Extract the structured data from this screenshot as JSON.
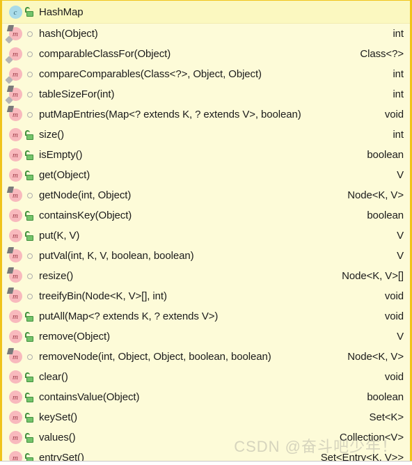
{
  "panel": {
    "kind": "structure-popup",
    "accent_border_color": "#f0c419",
    "background_color": "#fdfbd8",
    "header_background_color": "#fbf8c0",
    "text_color": "#1b1b1b"
  },
  "header": {
    "icon": "class-icon",
    "visibility_icon": "lock-open-icon",
    "name": "HashMap",
    "type": ""
  },
  "members": [
    {
      "icon": "method-icon",
      "modifiers": [
        "static",
        "final"
      ],
      "visibility_icon": "dot-private-icon",
      "name": "hash(Object)",
      "type": "int"
    },
    {
      "icon": "method-icon",
      "modifiers": [
        "final"
      ],
      "visibility_icon": "dot-private-icon",
      "name": "comparableClassFor(Object)",
      "type": "Class<?>"
    },
    {
      "icon": "method-icon",
      "modifiers": [
        "final"
      ],
      "visibility_icon": "dot-private-icon",
      "name": "compareComparables(Class<?>, Object, Object)",
      "type": "int"
    },
    {
      "icon": "method-icon",
      "modifiers": [
        "static",
        "final"
      ],
      "visibility_icon": "dot-private-icon",
      "name": "tableSizeFor(int)",
      "type": "int"
    },
    {
      "icon": "method-icon",
      "modifiers": [
        "static"
      ],
      "visibility_icon": "dot-private-icon",
      "name": "putMapEntries(Map<? extends K, ? extends V>, boolean)",
      "type": "void"
    },
    {
      "icon": "method-icon",
      "modifiers": [],
      "visibility_icon": "lock-open-icon",
      "name": "size()",
      "type": "int"
    },
    {
      "icon": "method-icon",
      "modifiers": [],
      "visibility_icon": "lock-open-icon",
      "name": "isEmpty()",
      "type": "boolean"
    },
    {
      "icon": "method-icon",
      "modifiers": [],
      "visibility_icon": "lock-open-icon",
      "name": "get(Object)",
      "type": "V"
    },
    {
      "icon": "method-icon",
      "modifiers": [
        "static"
      ],
      "visibility_icon": "dot-private-icon",
      "name": "getNode(int, Object)",
      "type": "Node<K, V>"
    },
    {
      "icon": "method-icon",
      "modifiers": [],
      "visibility_icon": "lock-open-icon",
      "name": "containsKey(Object)",
      "type": "boolean"
    },
    {
      "icon": "method-icon",
      "modifiers": [],
      "visibility_icon": "lock-open-icon",
      "name": "put(K, V)",
      "type": "V"
    },
    {
      "icon": "method-icon",
      "modifiers": [
        "static"
      ],
      "visibility_icon": "dot-private-icon",
      "name": "putVal(int, K, V, boolean, boolean)",
      "type": "V"
    },
    {
      "icon": "method-icon",
      "modifiers": [
        "static"
      ],
      "visibility_icon": "dot-private-icon",
      "name": "resize()",
      "type": "Node<K, V>[]"
    },
    {
      "icon": "method-icon",
      "modifiers": [
        "static"
      ],
      "visibility_icon": "dot-private-icon",
      "name": "treeifyBin(Node<K, V>[], int)",
      "type": "void"
    },
    {
      "icon": "method-icon",
      "modifiers": [],
      "visibility_icon": "lock-open-icon",
      "name": "putAll(Map<? extends K, ? extends V>)",
      "type": "void"
    },
    {
      "icon": "method-icon",
      "modifiers": [],
      "visibility_icon": "lock-open-icon",
      "name": "remove(Object)",
      "type": "V"
    },
    {
      "icon": "method-icon",
      "modifiers": [
        "static"
      ],
      "visibility_icon": "dot-private-icon",
      "name": "removeNode(int, Object, Object, boolean, boolean)",
      "type": "Node<K, V>"
    },
    {
      "icon": "method-icon",
      "modifiers": [],
      "visibility_icon": "lock-open-icon",
      "name": "clear()",
      "type": "void"
    },
    {
      "icon": "method-icon",
      "modifiers": [],
      "visibility_icon": "lock-open-icon",
      "name": "containsValue(Object)",
      "type": "boolean"
    },
    {
      "icon": "method-icon",
      "modifiers": [],
      "visibility_icon": "lock-open-icon",
      "name": "keySet()",
      "type": "Set<K>"
    },
    {
      "icon": "method-icon",
      "modifiers": [],
      "visibility_icon": "lock-open-icon",
      "name": "values()",
      "type": "Collection<V>"
    },
    {
      "icon": "method-icon",
      "modifiers": [],
      "visibility_icon": "lock-open-icon",
      "name": "entrySet()",
      "type": "Set<Entry<K, V>>"
    }
  ],
  "watermark": {
    "text": "CSDN @奋斗吧少年！"
  }
}
